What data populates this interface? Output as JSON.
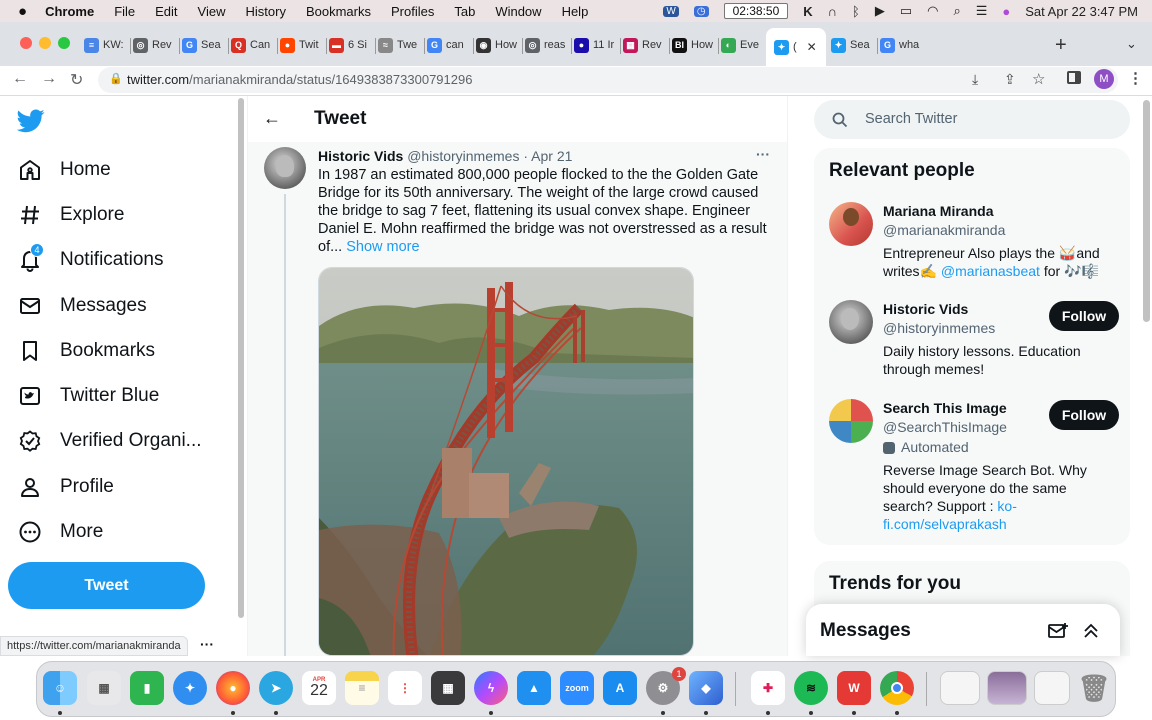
{
  "menubar": {
    "app": "Chrome",
    "items": [
      "File",
      "Edit",
      "View",
      "History",
      "Bookmarks",
      "Profiles",
      "Tab",
      "Window",
      "Help"
    ],
    "timer": "02:38:50",
    "datetime": "Sat Apr 22  3:47 PM"
  },
  "tabs": [
    {
      "label": "KW:",
      "color": "#4a86e8",
      "glyph": "≡"
    },
    {
      "label": "Rev",
      "color": "#5f6368",
      "glyph": "◎"
    },
    {
      "label": "Sea",
      "color": "#4285f4",
      "glyph": "G"
    },
    {
      "label": "Can",
      "color": "#d93025",
      "glyph": "Q"
    },
    {
      "label": "Twit",
      "color": "#ff4500",
      "glyph": "●"
    },
    {
      "label": "6 Si",
      "color": "#d93025",
      "glyph": "▬"
    },
    {
      "label": "Twe",
      "color": "#888888",
      "glyph": "≈"
    },
    {
      "label": "can",
      "color": "#4285f4",
      "glyph": "G"
    },
    {
      "label": "How",
      "color": "#333333",
      "glyph": "◉"
    },
    {
      "label": "reas",
      "color": "#5f6368",
      "glyph": "◎"
    },
    {
      "label": "11 Ir",
      "color": "#1a0dab",
      "glyph": "●"
    },
    {
      "label": "Rev",
      "color": "#c2185b",
      "glyph": "▦"
    },
    {
      "label": "How",
      "color": "#111111",
      "glyph": "BI"
    },
    {
      "label": "Eve",
      "color": "#34a853",
      "glyph": "◐"
    },
    {
      "label": "(",
      "color": "#1d9bf0",
      "glyph": "✦"
    },
    {
      "label": "Sea",
      "color": "#1d9bf0",
      "glyph": "✦"
    },
    {
      "label": "wha",
      "color": "#4285f4",
      "glyph": "G"
    }
  ],
  "toolbar": {
    "url_domain": "twitter.com",
    "url_path": "/marianakmiranda/status/1649383873300791296",
    "profile_initial": "M"
  },
  "nav": {
    "items": [
      {
        "label": "Home",
        "icon": "home-icon"
      },
      {
        "label": "Explore",
        "icon": "hashtag-icon"
      },
      {
        "label": "Notifications",
        "icon": "bell-icon"
      },
      {
        "label": "Messages",
        "icon": "envelope-icon"
      },
      {
        "label": "Bookmarks",
        "icon": "bookmark-icon"
      },
      {
        "label": "Twitter Blue",
        "icon": "twitter-blue-icon"
      },
      {
        "label": "Verified Organi...",
        "icon": "verified-icon"
      },
      {
        "label": "Profile",
        "icon": "person-icon"
      },
      {
        "label": "More",
        "icon": "more-icon"
      }
    ],
    "notification_count": "4",
    "tweet_button": "Tweet"
  },
  "header": {
    "title": "Tweet"
  },
  "tweet": {
    "name": "Historic Vids",
    "handle": "@historyinmemes",
    "sep": " · ",
    "date": "Apr 21",
    "text": "In 1987 an estimated 800,000 people flocked to the the Golden Gate Bridge for its 50th anniversary. The weight of the large crowd caused the bridge to sag 7 feet, flattening its usual convex shape. Engineer Daniel E. Mohn reaffirmed the bridge was not overstressed as a result of...",
    "show_more": "Show more"
  },
  "search": {
    "placeholder": "Search Twitter"
  },
  "relevant": {
    "title": "Relevant people",
    "people": [
      {
        "name": "Mariana Miranda",
        "handle": "@marianakmiranda",
        "bio_pre": "Entrepreneur Also plays the 🥁and writes✍️ ",
        "bio_link": "@marianasbeat",
        "bio_post": " for 🎶🎼",
        "follow": ""
      },
      {
        "name": "Historic Vids",
        "handle": "@historyinmemes",
        "bio_pre": "Daily history lessons. Education through memes!",
        "bio_link": "",
        "bio_post": "",
        "follow": "Follow"
      },
      {
        "name": "Search This Image",
        "handle": "@SearchThisImage",
        "automated": "Automated",
        "bio_pre": "Reverse Image Search Bot. Why should everyone do the same search? Support : ",
        "bio_link": "ko-fi.com/selvaprakash",
        "bio_post": "",
        "follow": "Follow"
      }
    ]
  },
  "trends": {
    "title": "Trends for you"
  },
  "messages_drawer": {
    "title": "Messages"
  },
  "status_url": "https://twitter.com/marianakmiranda",
  "calendar": {
    "month": "APR",
    "day": "22"
  },
  "dock_badge": "1",
  "colors": {
    "brand": "#1d9bf0",
    "text": "#0f1419",
    "muted": "#536471"
  }
}
